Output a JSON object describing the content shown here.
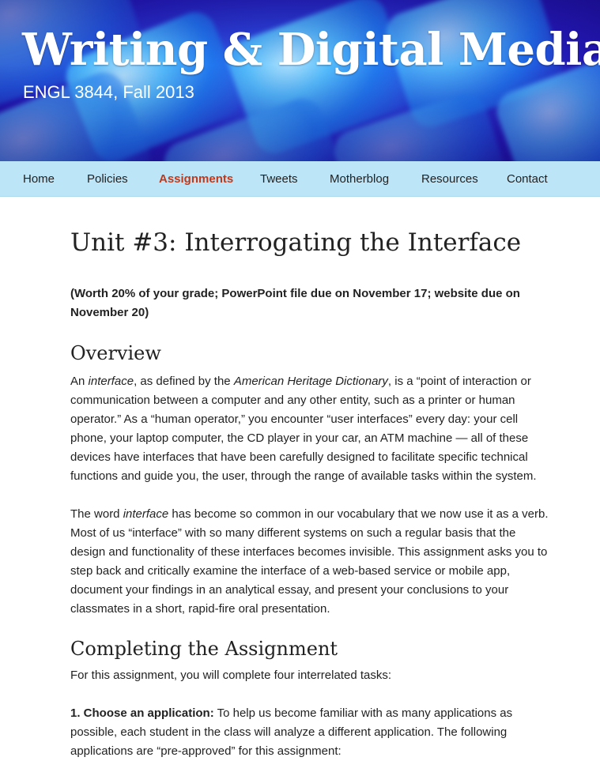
{
  "site": {
    "title": "Writing & Digital Media",
    "subtitle": "ENGL 3844, Fall 2013"
  },
  "nav": {
    "items": [
      {
        "label": "Home"
      },
      {
        "label": "Policies"
      },
      {
        "label": "Assignments",
        "active": true
      },
      {
        "label": "Tweets"
      },
      {
        "label": "Motherblog"
      },
      {
        "label": "Resources"
      },
      {
        "label": "Contact"
      }
    ]
  },
  "colors": {
    "nav_background": "#bde5f8",
    "nav_active": "#c0391b",
    "banner_blue": "#2a3fd6"
  },
  "article": {
    "title": "Unit #3: Interrogating the Interface",
    "worth": "(Worth 20% of your grade; PowerPoint file due on November 17; website due on November 20)",
    "overview_heading": "Overview",
    "p1": {
      "a": "An ",
      "b": "interface",
      "c": ", as defined by the ",
      "d": "American Heritage Dictionary",
      "e": ", is a “point of interaction or communication between a computer and any other entity, such as a printer or human operator.” As a “human operator,” you encounter “user interfaces” every day: your cell phone, your laptop computer, the CD player in your car, an ATM machine — all of these devices have interfaces that have been carefully designed to facilitate specific technical functions and guide you, the user, through the range of available tasks within the system."
    },
    "p2": {
      "a": "The word ",
      "b": "interface",
      "c": " has become so common in our vocabulary that we now use it as a verb. Most of us “interface” with so many different systems on such a regular basis that the design and functionality of these interfaces becomes invisible. This assignment asks you to step back and critically examine the interface of a web-based service or mobile app, document your findings in an analytical essay, and present your conclusions to your classmates in a short, rapid-fire oral presentation."
    },
    "completing_heading": "Completing the Assignment",
    "p3": "For this assignment, you will complete four interrelated tasks:",
    "p4": {
      "lead": "1. Choose an application:",
      "text": " To help us become familiar with as many applications as possible, each student in the class will analyze a different application. The following applications are “pre-approved” for this assignment:"
    }
  }
}
